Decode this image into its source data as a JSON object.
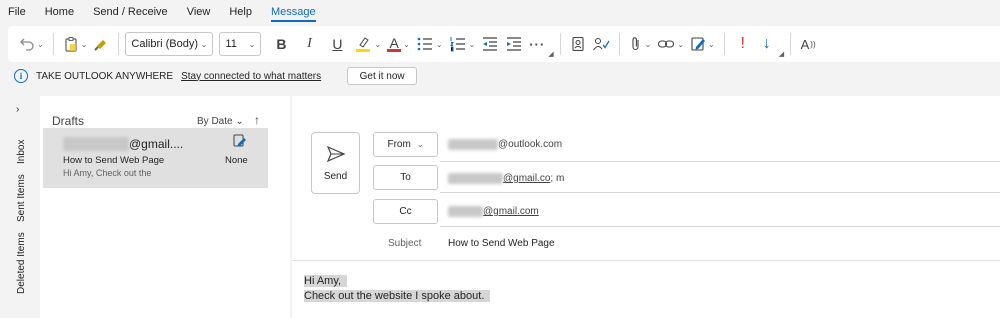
{
  "menu": {
    "items": [
      "File",
      "Home",
      "Send / Receive",
      "View",
      "Help",
      "Message"
    ],
    "active_label": "Message"
  },
  "ribbon": {
    "font_name": "Calibri (Body)",
    "font_size": "11",
    "bold_label": "B",
    "italic_label": "I",
    "underline_label": "U",
    "font_color_label": "A",
    "more_label": "···",
    "immersive_label": "A",
    "colors": {
      "highlight": "#ffd800",
      "font_color": "#d13438",
      "priority_high": "#d13438",
      "priority_low": "#0f6cbd"
    }
  },
  "infobar": {
    "title": "TAKE OUTLOOK ANYWHERE",
    "link": "Stay connected to what matters",
    "button": "Get it now"
  },
  "rail": {
    "items": [
      "Inbox",
      "Sent Items",
      "Deleted Items"
    ]
  },
  "folder": {
    "title": "Drafts",
    "sort": "By Date",
    "message": {
      "from_suffix": "@gmail....",
      "subject": "How to Send Web Page",
      "preview": "Hi Amy,  Check out the",
      "status": "None"
    }
  },
  "compose": {
    "send_label": "Send",
    "from_label": "From",
    "from_value_suffix": "@outlook.com",
    "to_label": "To",
    "to_value_suffix": "@gmail.co",
    "to_extra": "; m",
    "cc_label": "Cc",
    "cc_value_suffix": "@gmail.com",
    "subject_label": "Subject",
    "subject_value": "How to Send Web Page",
    "body_line1": "Hi Amy,",
    "body_line2": "Check out the website I spoke about."
  }
}
